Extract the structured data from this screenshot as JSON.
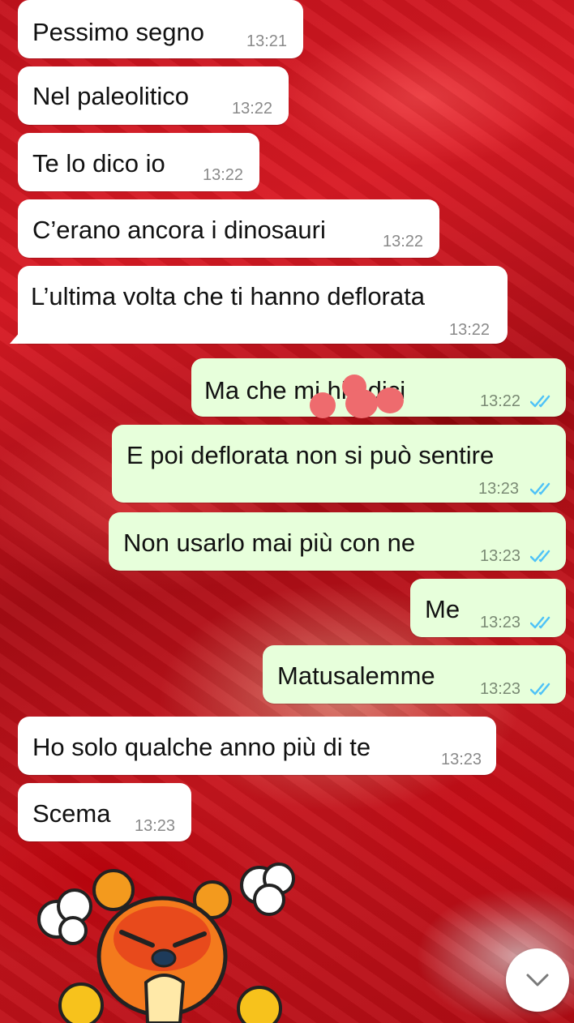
{
  "chat": {
    "messages": [
      {
        "text": "Pessimo segno",
        "time": "13:21",
        "dir": "in"
      },
      {
        "text": "Nel paleolitico",
        "time": "13:22",
        "dir": "in"
      },
      {
        "text": "Te lo dico io",
        "time": "13:22",
        "dir": "in"
      },
      {
        "text": "C’erano ancora i dinosauri",
        "time": "13:22",
        "dir": "in"
      },
      {
        "text": "L’ultima volta che ti hanno deflorata",
        "time": "13:22",
        "dir": "in"
      },
      {
        "text": "Ma che mi  hia dici",
        "time": "13:22",
        "dir": "out",
        "status": "read"
      },
      {
        "text": "E poi deflorata non si può sentire",
        "time": "13:23",
        "dir": "out",
        "status": "read"
      },
      {
        "text": "Non usarlo mai più con ne",
        "time": "13:23",
        "dir": "out",
        "status": "read"
      },
      {
        "text": "Me",
        "time": "13:23",
        "dir": "out",
        "status": "read"
      },
      {
        "text": "Matusalemme",
        "time": "13:23",
        "dir": "out",
        "status": "read"
      },
      {
        "text": "Ho solo qualche anno più di te",
        "time": "13:23",
        "dir": "in"
      },
      {
        "text": "Scema",
        "time": "13:23",
        "dir": "in"
      }
    ],
    "sticker": {
      "icon": "angry-bear-sticker"
    },
    "scroll_button": {
      "icon": "chevron-down-icon"
    }
  },
  "colors": {
    "incoming_bubble": "#ffffff",
    "outgoing_bubble": "#e7ffdb",
    "read_ticks": "#4fc3f7",
    "wallpaper": "#c4121c"
  }
}
